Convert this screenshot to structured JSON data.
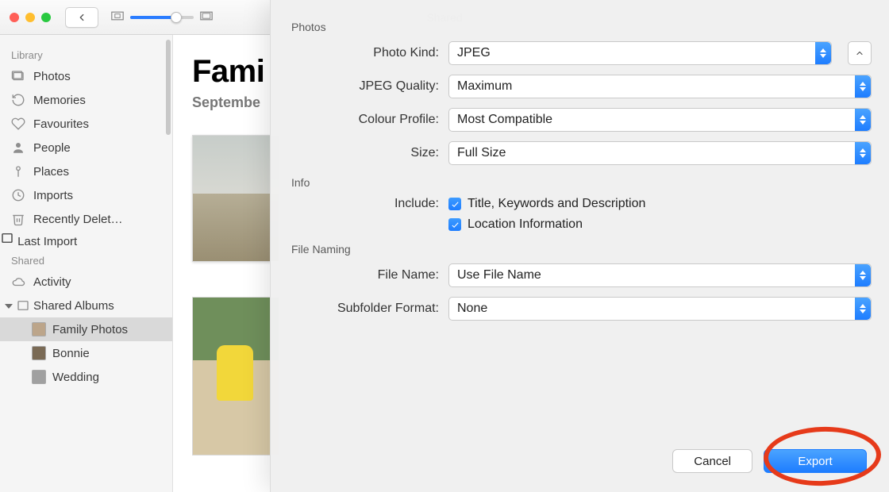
{
  "window": {
    "title": "Shared"
  },
  "toolbar": {
    "zoom_percent": 72
  },
  "sidebar": {
    "sections": {
      "library": {
        "title": "Library",
        "items": [
          {
            "label": "Photos"
          },
          {
            "label": "Memories"
          },
          {
            "label": "Favourites"
          },
          {
            "label": "People"
          },
          {
            "label": "Places"
          },
          {
            "label": "Imports"
          },
          {
            "label": "Recently Delet…"
          },
          {
            "label": "Last Import"
          }
        ]
      },
      "shared": {
        "title": "Shared",
        "activity": {
          "label": "Activity"
        },
        "shared_albums": {
          "label": "Shared Albums"
        },
        "albums": [
          {
            "label": "Family Photos"
          },
          {
            "label": "Bonnie"
          },
          {
            "label": "Wedding"
          }
        ]
      }
    }
  },
  "content": {
    "heading": "Fami",
    "subheading": "Septembe"
  },
  "sheet": {
    "groups": {
      "photos": {
        "title": "Photos"
      },
      "info": {
        "title": "Info"
      },
      "file_naming": {
        "title": "File Naming"
      }
    },
    "labels": {
      "photo_kind": "Photo Kind:",
      "jpeg_quality": "JPEG Quality:",
      "colour_profile": "Colour Profile:",
      "size": "Size:",
      "include": "Include:",
      "file_name": "File Name:",
      "subfolder_format": "Subfolder Format:"
    },
    "values": {
      "photo_kind": "JPEG",
      "jpeg_quality": "Maximum",
      "colour_profile": "Most Compatible",
      "size": "Full Size",
      "file_name": "Use File Name",
      "subfolder_format": "None"
    },
    "checkboxes": {
      "title_keywords": {
        "label": "Title, Keywords and Description",
        "checked": true
      },
      "location": {
        "label": "Location Information",
        "checked": true
      }
    },
    "buttons": {
      "cancel": "Cancel",
      "export": "Export"
    }
  }
}
